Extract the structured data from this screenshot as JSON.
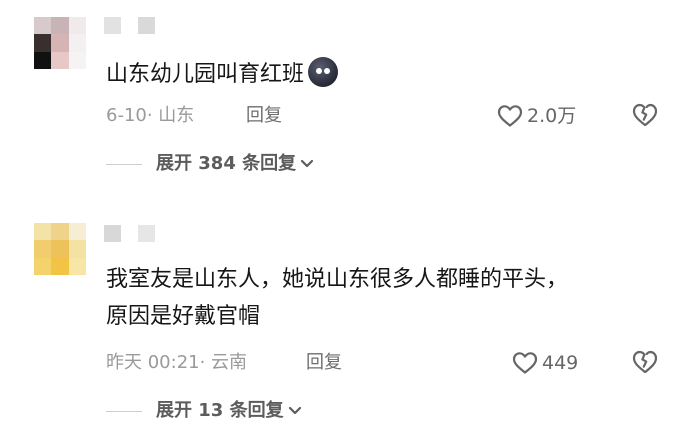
{
  "comments": [
    {
      "avatar_colors": [
        "#d8c9cc",
        "#c8b3b7",
        "#f1eaeb",
        "#3a2f2f",
        "#d7b4b4",
        "#f2f0f0",
        "#111111",
        "#e7c8c6",
        "#f6f3f3"
      ],
      "username_colors": [
        "#e2e2e2",
        "#ffffff",
        "#d9d9d9"
      ],
      "text": "山东幼儿园叫育红班",
      "emoji": "dark-face-emoji",
      "date": "6-10",
      "location": "· 山东",
      "reply_label": "回复",
      "like_count": "2.0万",
      "expand_label": "展开 384 条回复"
    },
    {
      "avatar_colors": [
        "#f3e3a7",
        "#f0d38a",
        "#f6eed2",
        "#f2cd6d",
        "#eec25a",
        "#f4e1a4",
        "#f4d36d",
        "#f3c444",
        "#f8e6a6"
      ],
      "username_colors": [
        "#d8d8d8",
        "#ffffff",
        "#e6e6e6"
      ],
      "text_lines": [
        "我室友是山东人，她说山东很多人都睡的平头，",
        "原因是好戴官帽"
      ],
      "date": "昨天 00:21",
      "location": "· 云南",
      "reply_label": "回复",
      "like_count": "449",
      "expand_label": "展开 13 条回复"
    }
  ],
  "colors": {
    "meta_gray": "#9a9a9a",
    "icon_gray": "#666666"
  },
  "icons": {
    "like": "heart-outline-icon",
    "dislike": "broken-heart-icon",
    "expand": "chevron-down-icon"
  }
}
